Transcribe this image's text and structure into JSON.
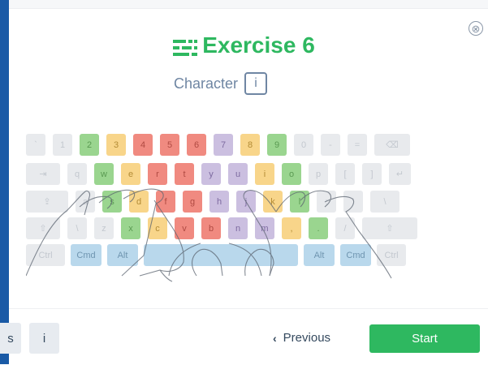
{
  "header": {
    "title": "Exercise 6",
    "close_label": "⊗"
  },
  "character": {
    "label": "Character",
    "value": "i"
  },
  "icons": {
    "title": "exercise-lines-icon",
    "close": "close-circle-icon",
    "previous": "chevron-left-icon"
  },
  "colors": {
    "accent": "#2eb860",
    "sidebar": "#1a5aa6",
    "inactive_key": "#e8eaed"
  },
  "keyboard": {
    "rows": [
      [
        {
          "label": "`"
        },
        {
          "label": "1"
        },
        {
          "label": "2",
          "color": "green"
        },
        {
          "label": "3",
          "color": "yellow"
        },
        {
          "label": "4",
          "color": "red"
        },
        {
          "label": "5",
          "color": "red"
        },
        {
          "label": "6",
          "color": "red"
        },
        {
          "label": "7",
          "color": "purple"
        },
        {
          "label": "8",
          "color": "yellow"
        },
        {
          "label": "9",
          "color": "green"
        },
        {
          "label": "0"
        },
        {
          "label": "-"
        },
        {
          "label": "="
        },
        {
          "label": "⌫"
        }
      ],
      [
        {
          "label": "⇥"
        },
        {
          "label": "q"
        },
        {
          "label": "w",
          "color": "green"
        },
        {
          "label": "e",
          "color": "yellow"
        },
        {
          "label": "r",
          "color": "red"
        },
        {
          "label": "t",
          "color": "red"
        },
        {
          "label": "y",
          "color": "purple"
        },
        {
          "label": "u",
          "color": "purple"
        },
        {
          "label": "i",
          "color": "yellow"
        },
        {
          "label": "o",
          "color": "green"
        },
        {
          "label": "p"
        },
        {
          "label": "["
        },
        {
          "label": "]"
        },
        {
          "label": "↵"
        }
      ],
      [
        {
          "label": "⇪"
        },
        {
          "label": "a"
        },
        {
          "label": "s",
          "color": "green"
        },
        {
          "label": "d",
          "color": "yellow"
        },
        {
          "label": "f",
          "color": "red"
        },
        {
          "label": "g",
          "color": "red"
        },
        {
          "label": "h",
          "color": "purple"
        },
        {
          "label": "j",
          "color": "purple"
        },
        {
          "label": "k",
          "color": "yellow"
        },
        {
          "label": "l",
          "color": "green"
        },
        {
          "label": ";"
        },
        {
          "label": "'"
        },
        {
          "label": "\\"
        }
      ],
      [
        {
          "label": "⇧"
        },
        {
          "label": "\\"
        },
        {
          "label": "z"
        },
        {
          "label": "x",
          "color": "green"
        },
        {
          "label": "c",
          "color": "yellow"
        },
        {
          "label": "v",
          "color": "red"
        },
        {
          "label": "b",
          "color": "red"
        },
        {
          "label": "n",
          "color": "purple"
        },
        {
          "label": "m",
          "color": "purple"
        },
        {
          "label": ",",
          "color": "yellow"
        },
        {
          "label": ".",
          "color": "green"
        },
        {
          "label": "/"
        },
        {
          "label": "⇧"
        }
      ],
      [
        {
          "label": "Ctrl"
        },
        {
          "label": "Cmd",
          "color": "blue"
        },
        {
          "label": "Alt",
          "color": "blue"
        },
        {
          "label": "",
          "color": "blue"
        },
        {
          "label": "Alt",
          "color": "blue"
        },
        {
          "label": "Cmd",
          "color": "blue"
        },
        {
          "label": "Ctrl"
        }
      ]
    ]
  },
  "nav": {
    "prev_chip_label": "s",
    "next_chip_label": "i",
    "previous_label": "Previous",
    "start_label": "Start"
  }
}
